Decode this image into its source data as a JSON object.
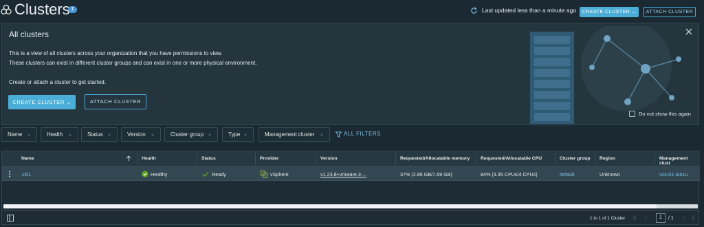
{
  "header": {
    "title": "Clusters",
    "count": "1",
    "last_updated": "Last updated less than a minute ago",
    "create_label": "CREATE CLUSTER ⌄",
    "attach_label": "ATTACH CLUSTER"
  },
  "banner": {
    "title": "All clusters",
    "line1": "This is a view of all clusters across your organization that you have permissions to view.",
    "line2": "These clusters can exist in different cluster groups and can exist in one or more physical environment.",
    "line3": "Create or attach a cluster to get started.",
    "create_label": "CREATE CLUSTER ⌄",
    "attach_label": "ATTACH CLUSTER",
    "dont_show_label": "Do not show this again"
  },
  "filters": {
    "items": [
      "Name",
      "Health",
      "Status",
      "Version",
      "Cluster group",
      "Type",
      "Management cluster"
    ],
    "all_filters_label": "ALL FILTERS"
  },
  "table": {
    "columns": [
      "Name",
      "Health",
      "Status",
      "Provider",
      "Version",
      "Requested/Allocatable memory",
      "Requested/Allocatable CPU",
      "Cluster group",
      "Region",
      "Management clust"
    ],
    "rows": [
      {
        "name": "cl01",
        "health": "Healthy",
        "status": "Ready",
        "provider": "vSphere",
        "version": "v1.23.8+vmware.3-...",
        "memory": "37% (2.86 GB/7.69 GB)",
        "cpu": "84% (3.35 CPUs/4 CPUs)",
        "cluster_group": "default",
        "region": "Unknown",
        "management_cluster": "vcs-01-tanzu"
      }
    ],
    "footer_text": "1 to 1 of 1 Cluster",
    "page_current": "1",
    "page_total": "/ 1"
  },
  "colors": {
    "accent": "#4aaed9",
    "link": "#7fc2ea",
    "healthy": "#62a420",
    "background": "#1b2a32"
  }
}
